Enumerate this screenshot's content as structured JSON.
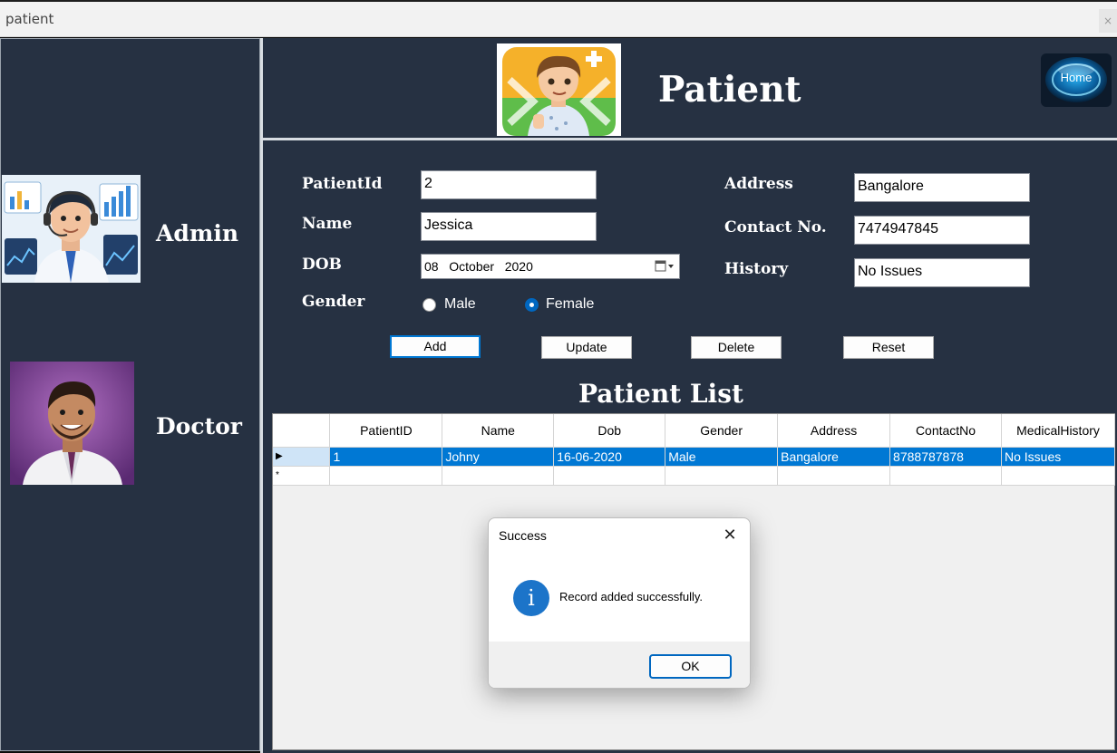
{
  "window": {
    "title": "patient",
    "close_glyph": "×"
  },
  "sidebar": {
    "admin_label": "Admin",
    "doctor_label": "Doctor"
  },
  "header": {
    "title": "Patient",
    "home_button_label": "Home"
  },
  "form": {
    "patient_id": {
      "label": "PatientId",
      "value": "2"
    },
    "name": {
      "label": "Name",
      "value": "Jessica"
    },
    "dob": {
      "label": "DOB",
      "day": "08",
      "month": "October",
      "year": "2020"
    },
    "gender": {
      "label": "Gender",
      "options": [
        "Male",
        "Female"
      ],
      "selected": "Female"
    },
    "address": {
      "label": "Address",
      "value": "Bangalore"
    },
    "contact": {
      "label": "Contact No.",
      "value": "7474947845"
    },
    "history": {
      "label": "History",
      "value": "No Issues"
    }
  },
  "buttons": {
    "add": "Add",
    "update": "Update",
    "delete": "Delete",
    "reset": "Reset"
  },
  "list": {
    "title": "Patient List",
    "columns": [
      "PatientID",
      "Name",
      "Dob",
      "Gender",
      "Address",
      "ContactNo",
      "MedicalHistory"
    ],
    "rows": [
      [
        "1",
        "Johny",
        "16-06-2020",
        "Male",
        "Bangalore",
        "8788787878",
        "No Issues"
      ]
    ],
    "current_row_glyph": "▶",
    "new_row_glyph": "*"
  },
  "dialog": {
    "title": "Success",
    "message": "Record added successfully.",
    "ok_label": "OK",
    "icon_glyph": "i",
    "close_glyph": "✕"
  },
  "colors": {
    "panel_bg": "#263142",
    "selection": "#0078d4",
    "accent": "#0067c0"
  },
  "icons": {
    "patient_logo": "patient-boy-illustration-icon",
    "admin_avatar": "admin-headset-avatar-icon",
    "doctor_avatar": "doctor-avatar-icon",
    "home_button": "home-orb-icon",
    "calendar": "calendar-dropdown-icon",
    "dialog_info": "info-icon"
  }
}
